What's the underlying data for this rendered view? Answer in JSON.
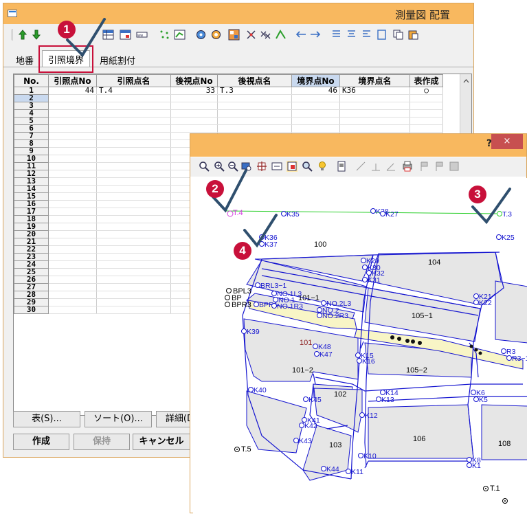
{
  "main_window": {
    "title": "測量図 配置",
    "tabs": [
      {
        "label": "地番"
      },
      {
        "label": "引照境界"
      },
      {
        "label": "用紙割付"
      }
    ],
    "columns": [
      "No.",
      "引照点No",
      "引照点名",
      "後視点No",
      "後視点名",
      "境界点No",
      "境界点名",
      "表作成"
    ],
    "rows": [
      {
        "no": "1",
        "ref_no": "44",
        "ref_name": "T.4",
        "back_no": "33",
        "back_name": "T.3",
        "bound_no": "46",
        "bound_name": "K36",
        "make": "○"
      },
      {
        "no": "2"
      },
      {
        "no": "3"
      },
      {
        "no": "4"
      },
      {
        "no": "5"
      },
      {
        "no": "6"
      },
      {
        "no": "7"
      },
      {
        "no": "8"
      },
      {
        "no": "9"
      },
      {
        "no": "10"
      },
      {
        "no": "11"
      },
      {
        "no": "12"
      },
      {
        "no": "13"
      },
      {
        "no": "14"
      },
      {
        "no": "15"
      },
      {
        "no": "16"
      },
      {
        "no": "17"
      },
      {
        "no": "18"
      },
      {
        "no": "19"
      },
      {
        "no": "20"
      },
      {
        "no": "21"
      },
      {
        "no": "22"
      },
      {
        "no": "23"
      },
      {
        "no": "24"
      },
      {
        "no": "25"
      },
      {
        "no": "26"
      },
      {
        "no": "27"
      },
      {
        "no": "28"
      },
      {
        "no": "29"
      },
      {
        "no": "30"
      }
    ],
    "buttons": {
      "table": "表(S)...",
      "sort": "ソート(O)...",
      "detail": "詳細(D",
      "create": "作成",
      "hold": "保持",
      "cancel": "キャンセル"
    }
  },
  "map_window": {
    "help": "?",
    "close": "×",
    "parcels": [
      "100",
      "104",
      "101−1",
      "105−1",
      "101",
      "101−2",
      "105−2",
      "102",
      "106",
      "103",
      "108"
    ],
    "points": [
      "T.4",
      "K35",
      "K28",
      "K27",
      "T.3",
      "K36",
      "K37",
      "K25",
      "K29",
      "K30",
      "K32",
      "BPL3",
      "BP",
      "BPR3",
      "BRL3−1",
      "NO.1L3",
      "NO.1",
      "BPR1",
      "NO.1R3",
      "NO.2L3",
      "NO.2",
      "NO.2R3",
      "K21",
      "K22",
      "K39",
      "K48",
      "K47",
      "K15",
      "K16",
      "K40",
      "K14",
      "K13",
      "K6",
      "K5",
      "K45",
      "K12",
      "K41",
      "K42",
      "K43",
      "T.5",
      "K10",
      "K8",
      "K1",
      "K44",
      "K11",
      "T.1",
      "R3−1",
      "R3",
      "K31"
    ]
  },
  "callouts": [
    "1",
    "2",
    "3",
    "4"
  ],
  "colors": {
    "titlebar": "#f8b85f",
    "badge": "#c8103a",
    "check": "#2f4f6e",
    "highlight_frame": "#c8103a",
    "line_blue": "#1515d0",
    "line_green": "#2bcf2b",
    "parcel_fill": "#e6e6e6",
    "road_fill": "#f8f5c6"
  }
}
